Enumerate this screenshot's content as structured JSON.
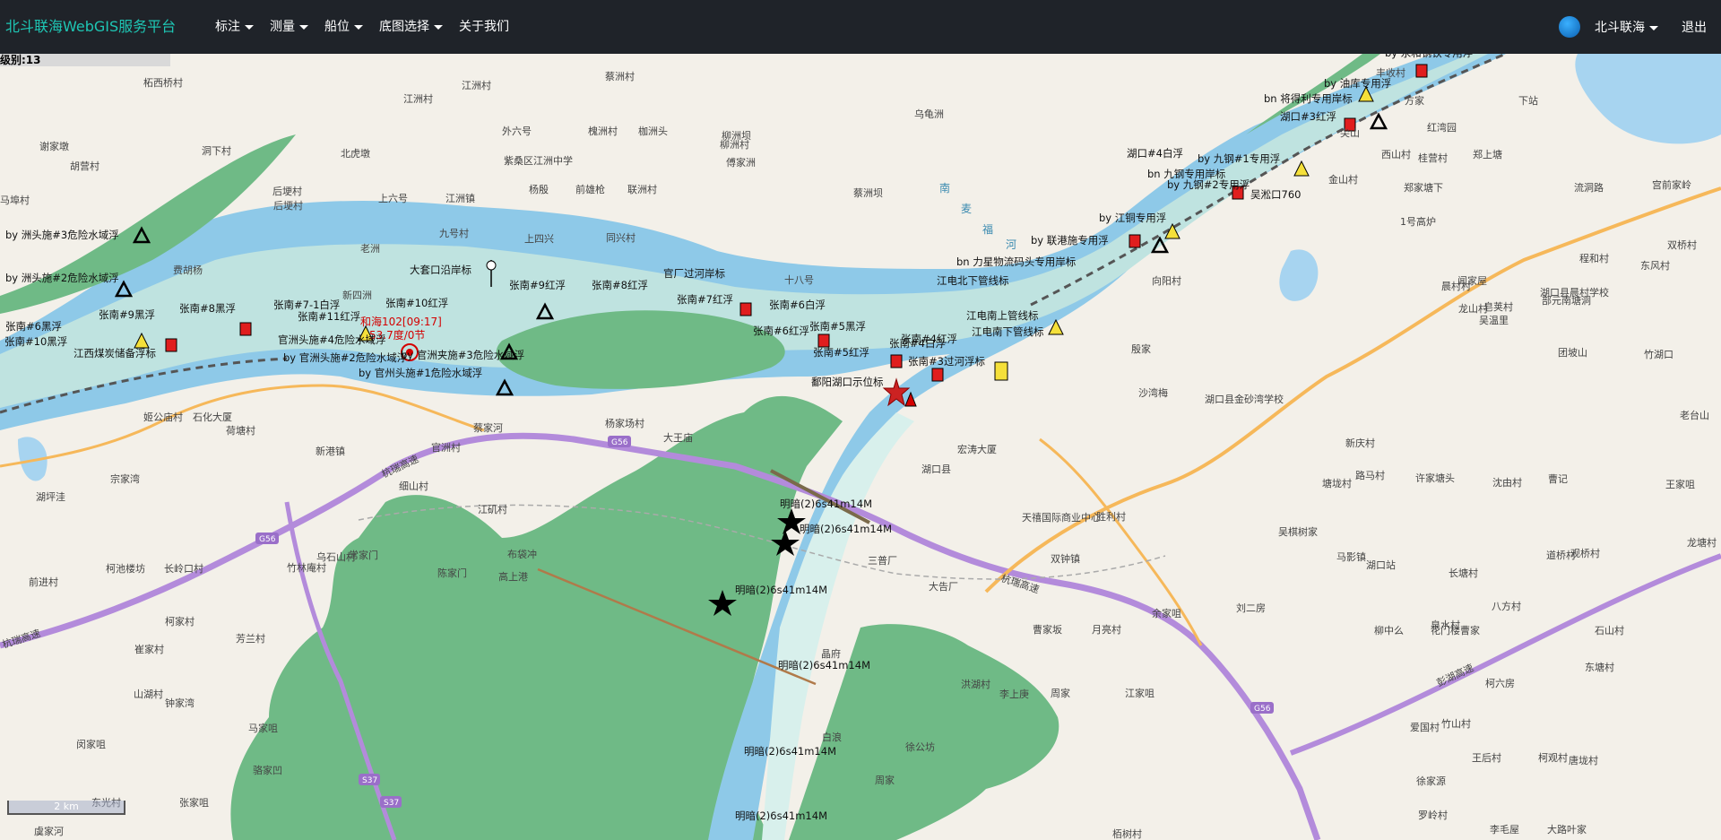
{
  "app": {
    "brand": "北斗联海WebGIS服务平台",
    "menu": [
      "标注",
      "测量",
      "船位",
      "底图选择",
      "关于我们"
    ],
    "user": "北斗联海",
    "logout": "退出",
    "zoom_level": "级别:13",
    "scale": "2 km"
  },
  "map": {
    "ship_label_1": "和海102[09:17]",
    "ship_label_2": "53.7度/0节",
    "place_labels": [
      "柘西桥村",
      "江洲村",
      "蔡洲村",
      "丰收村",
      "洞下村",
      "江洲村",
      "马埠村",
      "胡营村",
      "谢家墩",
      "紫桑区江洲中学",
      "北虎墩",
      "外六号",
      "槐洲村",
      "枷洲头",
      "柳洲坝",
      "柳洲村",
      "乌龟洲",
      "上六号",
      "江洲镇",
      "杨殷",
      "前雄枪",
      "联洲村",
      "傅家洲",
      "蔡洲坝",
      "后埂村",
      "后埂村",
      "九号村",
      "同兴村",
      "老洲",
      "费胡杨",
      "上四兴",
      "十八号",
      "新四洲",
      "石化大厦",
      "荷塘村",
      "姬公庙村",
      "新港镇",
      "官洲村",
      "蔡家河",
      "杨家场村",
      "大王庙",
      "宗家湾",
      "湖坪洼",
      "细山村",
      "江矶村",
      "布袋冲",
      "陈家门",
      "高上港",
      "乌石山村",
      "常家门",
      "竹林庵村",
      "前进村",
      "柯池楼坊",
      "长岭口村",
      "柯家村",
      "崔家村",
      "芳兰村",
      "山湖村",
      "钟家湾",
      "闵家咀",
      "马家咀",
      "骆家凹",
      "张家咀",
      "东光村",
      "虞家河",
      "宏涛大厦",
      "湖口县",
      "天禧国际商业中心",
      "双钟镇",
      "三普厂",
      "大告厂",
      "曹家坂",
      "月亮村",
      "洪湖村",
      "李上庚",
      "周家",
      "江家咀",
      "晶府",
      "白浪",
      "周家",
      "徐公坊",
      "栢树村",
      "胜利村",
      "余家咀",
      "刘二房",
      "马影镇",
      "湖口站",
      "吴棋树家",
      "长塘村",
      "八方村",
      "道桥村",
      "观桥村",
      "柳中么",
      "花门楼曹家",
      "泉水村",
      "石山村",
      "东塘村",
      "柯六房",
      "爱国村",
      "竹山村",
      "王后村",
      "柯观村",
      "唐垅村",
      "徐家源",
      "罗岭村",
      "李毛屋",
      "大路叶家",
      "塘垅村",
      "路马村",
      "许家塘头",
      "沈由村",
      "曹记",
      "王家咀",
      "龙塘村",
      "金山村",
      "郑家塘下",
      "流洞路",
      "宫前家岭",
      "双桥村",
      "东风村",
      "程和村",
      "部元南塘洞",
      "竹湖口",
      "老台山",
      "团坡山",
      "沙湾梅",
      "殷家",
      "向阳村",
      "湖口县金砂湾学校",
      "新庆村",
      "闻家屋",
      "吴温里",
      "皂荚村",
      "晨村村",
      "湖口县晨村学校",
      "龙山村",
      "郑上塘",
      "桂营村",
      "西山村",
      "尖山",
      "方家",
      "红湾园",
      "下站",
      "1号高炉"
    ],
    "nav_labels": [
      "by 洲头施#3危险水域浮",
      "by 洲头施#2危险水域浮",
      "张南#7-1白浮",
      "张南#10红浮",
      "张南#9红浮",
      "张南#8红浮",
      "张南#11红浮",
      "张南#8黑浮",
      "张南#9黑浮",
      "张南#6黑浮",
      "张南#10黑浮",
      "张南#7红浮",
      "张南#6红浮",
      "张南#6白浮",
      "张南#5黑浮",
      "张南#5红浮",
      "张南#4白浮",
      "张南#4红浮",
      "张南#3过河浮标",
      "江西煤炭储备浮标",
      "官洲头施#4危险水域浮",
      "by 官洲头施#2危险水域浮",
      "by 官州头施#1危险水域浮",
      "by 官洲夹施#3危险水域浮",
      "大套口沿岸标",
      "官厂过河岸标",
      "鄱阳湖口示位标",
      "江电北下管线标",
      "江电南上管线标",
      "江电南下管线标",
      "bn 力星物流码头专用岸标",
      "by 联港施专用浮",
      "by 江铜专用浮",
      "湖口#4白浮",
      "by 九钢#1专用浮",
      "bn 九钢专用岸标",
      "by 九钢#2专用浮",
      "bn 将得利专用岸标",
      "by 油库专用浮",
      "湖口#3红浮",
      "by 永和钢铁专用浮",
      "吴淞口760",
      "明暗(2)6s41m14M",
      "明暗(2)6s41m14M",
      "明暗(2)6s41m14M",
      "明暗(2)6s41m14M",
      "明暗(2)6s41m14M",
      "明暗(2)6s41m14M"
    ],
    "highway_labels": [
      "杭瑞高速",
      "杭瑞高速",
      "杭瑞高速",
      "彭湖高速",
      "G56",
      "G56",
      "G56",
      "S37",
      "S37",
      "G56"
    ],
    "river_labels": [
      "南",
      "麦",
      "福",
      "河"
    ],
    "colors": {
      "navbar": "#1f2329",
      "brand": "#1ec6b4",
      "land": "#f3f0e9",
      "wetland": "#6fba86",
      "river": "#8ec9e8",
      "channel": "#bfe3e0",
      "highway": "#b38bdb",
      "trunk": "#f6b85a",
      "ship": "#d40000"
    }
  }
}
